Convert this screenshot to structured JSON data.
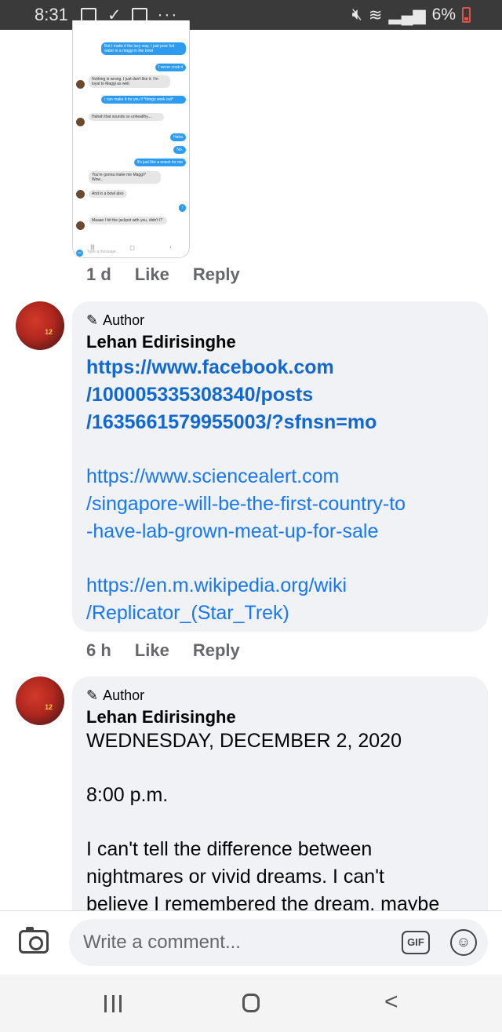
{
  "status_bar": {
    "time": "8:31",
    "battery": "6%",
    "overflow": "···"
  },
  "embedded_chat": {
    "messages": [
      {
        "side": "out",
        "text": "But I make it the lazy way. I just pour hot water in a maggi in the bowl"
      },
      {
        "side": "out",
        "text": "I never cook it"
      },
      {
        "side": "in",
        "text": "Nothing is wrong. I just don't like it. I'm loyal to Maggi as well."
      },
      {
        "side": "out",
        "text": "I can make it for you if *things work out*"
      },
      {
        "side": "in",
        "text": "Hahah that sounds so unhealthy...."
      },
      {
        "side": "out",
        "text": "Haha"
      },
      {
        "side": "out",
        "text": "No."
      },
      {
        "side": "out",
        "text": "It's just like a snack for me"
      },
      {
        "side": "in",
        "text": "You're gonna make me Maggi? Wow..."
      },
      {
        "side": "in",
        "text": "And in a bowl also"
      },
      {
        "side": "out",
        "text": "!"
      },
      {
        "side": "in",
        "text": "Maaan I hit the jackpot with you, didn't I?"
      }
    ],
    "input_placeholder": "Type a message...",
    "gif_label": "GIF"
  },
  "comment_meta_1": {
    "time": "1 d",
    "like": "Like",
    "reply": "Reply"
  },
  "comment_2": {
    "badge": "Author",
    "author": "Lehan Edirisinghe",
    "links": [
      {
        "lines": [
          "https://www.facebook.com",
          "/100005335308340/posts",
          "/1635661579955003/?sfnsn=mo"
        ]
      },
      {
        "lines": [
          "https://www.sciencealert.com",
          "/singapore-will-be-the-first-country-to",
          "-have-lab-grown-meat-up-for-sale"
        ]
      },
      {
        "lines": [
          "https://en.m.wikipedia.org/wiki",
          "/Replicator_(Star_Trek)"
        ]
      }
    ]
  },
  "comment_meta_2": {
    "time": "6 h",
    "like": "Like",
    "reply": "Reply"
  },
  "comment_3": {
    "badge": "Author",
    "author": "Lehan Edirisinghe",
    "date_line": "WEDNESDAY,  DECEMBER  2,  2020",
    "time_line": "8:00 p.m.",
    "text_lines": [
      "I can't tell the difference between",
      "nightmares or vivid dreams. I can't",
      "believe I remembered the dream, maybe"
    ]
  },
  "composer": {
    "placeholder": "Write a comment...",
    "gif_label": "GIF"
  }
}
